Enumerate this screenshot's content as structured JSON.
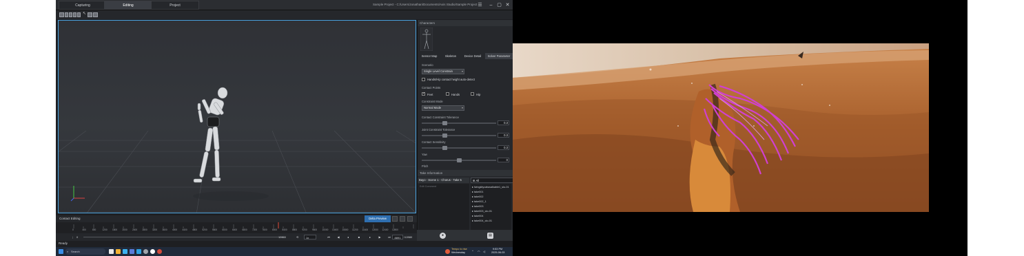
{
  "tabs": [
    {
      "label": "Capturing"
    },
    {
      "label": "Editing"
    },
    {
      "label": "Project"
    }
  ],
  "window": {
    "title": "Sample Project - C:/Users/Jonathan/Documents/Axis Studio/Sample Project"
  },
  "panel": {
    "characters_header": "Characters",
    "sub_tabs": [
      "Sensor Map",
      "Skeleton",
      "Device Detail",
      "Solver Parameter"
    ],
    "scenario_label": "Scenario",
    "scenario_value": "Single Level Constrain",
    "auto_detect_label": "Hands/Hip contact height auto-detect",
    "contact_points_label": "Contact Points",
    "contact_points": [
      {
        "label": "Feet",
        "checked": true
      },
      {
        "label": "Hands",
        "checked": false
      },
      {
        "label": "Hip",
        "checked": false
      }
    ],
    "constraint_mode_label": "Constraint Mode",
    "constraint_mode_value": "Normal Mode",
    "sliders": [
      {
        "label": "Contact Constraint Tolerance",
        "value": "0.3",
        "level": 0.3
      },
      {
        "label": "Joint Constraint Tolerance",
        "value": "0.3",
        "level": 0.3
      },
      {
        "label": "Contact Sensitivity",
        "value": "0.3",
        "level": 0.3
      },
      {
        "label": "Yaw",
        "value": "0",
        "level": 0.5
      }
    ],
    "pitch_label": "Pitch",
    "take_info_header": "Take Information",
    "take_name": "Bayo - Scene 1 - Chorus - Take 5",
    "notes_placeholder": "Edit Comment",
    "filter_value": "All",
    "files": [
      "livingkitycatswalkable1_slo-01",
      "take001",
      "take002",
      "take002_1",
      "take003",
      "take003_clo-01",
      "take004",
      "take004_clo-01"
    ]
  },
  "contact_editing_label": "Contact Editing",
  "delta_preview_label": "Delta Preview",
  "timeline": {
    "ticks": [
      "0",
      "400",
      "800",
      "1200",
      "1600",
      "2000",
      "2400",
      "2800",
      "3200",
      "3600",
      "4000",
      "4400",
      "4800",
      "5200",
      "5600",
      "6000",
      "6400",
      "6800",
      "7200",
      "7600",
      "8000",
      "8400",
      "8800",
      "9200",
      "9600",
      "10000",
      "10400",
      "10800",
      "11200",
      "11600",
      "12000",
      "12400",
      "12800"
    ],
    "range_start": "0",
    "range_end": "12880",
    "speed": "1x",
    "current_frame": "8891",
    "total_frames": "/12880"
  },
  "status_text": "Ready",
  "taskbar": {
    "search_label": "Search",
    "weather_line1": "Tempo to rise",
    "weather_line2": "Wednesday",
    "time": "9:53 PM",
    "date": "2025-06-03"
  },
  "colors": {
    "accent": "#4aa3e0",
    "button_blue": "#2f6fb0",
    "window_bg": "#1e1f22",
    "viewport_bg": "#35383d"
  }
}
